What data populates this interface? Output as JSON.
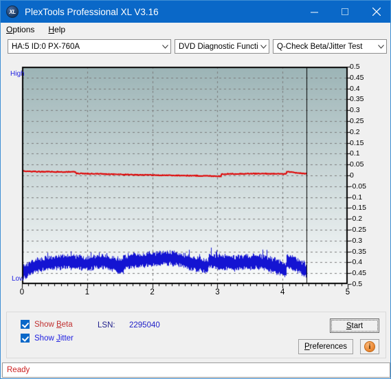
{
  "window": {
    "title": "PlexTools Professional XL V3.16",
    "icon": "XL",
    "icon_name": "plextools-app-icon",
    "minimize": "minimize-icon",
    "maximize": "maximize-icon",
    "close": "close-icon",
    "accent": "#0a68c8"
  },
  "menubar": {
    "items": [
      {
        "label": "Options",
        "accel": "O"
      },
      {
        "label": "Help",
        "accel": "H"
      }
    ]
  },
  "toolbar": {
    "drive": {
      "value": "HA:5 ID:0  PX-760A",
      "options": [
        "HA:5 ID:0  PX-760A"
      ]
    },
    "function": {
      "value": "DVD Diagnostic Functions",
      "options": [
        "DVD Diagnostic Functions"
      ]
    },
    "test": {
      "value": "Q-Check Beta/Jitter Test",
      "options": [
        "Q-Check Beta/Jitter Test"
      ]
    }
  },
  "chart_labels": {
    "high": "High",
    "low": "Low"
  },
  "controls": {
    "show_beta": {
      "label": "Show Beta",
      "accel": "B",
      "checked": true,
      "color": "#c03030"
    },
    "show_jitter": {
      "label": "Show Jitter",
      "accel": "J",
      "checked": true,
      "color": "#2020e0"
    },
    "lsn_label": "LSN:",
    "lsn_value": "2295040",
    "start_button": {
      "label": "Start",
      "accel": "S"
    },
    "preferences_button": {
      "label": "Preferences",
      "accel": "P"
    },
    "info_button": {
      "label": "i",
      "name": "info-icon"
    }
  },
  "statusbar": {
    "text": "Ready",
    "color": "#cc2020"
  },
  "chart_data": {
    "type": "line",
    "title": "Q-Check Beta/Jitter Test",
    "xlabel": "",
    "ylabel": "",
    "xlim": [
      0,
      5
    ],
    "ylim": [
      -0.5,
      0.5
    ],
    "xticks": [
      0,
      1,
      2,
      3,
      4,
      5
    ],
    "yticks": [
      0.5,
      0.45,
      0.4,
      0.35,
      0.3,
      0.25,
      0.2,
      0.15,
      0.1,
      0.05,
      0,
      -0.05,
      -0.1,
      -0.15,
      -0.2,
      -0.25,
      -0.3,
      -0.35,
      -0.4,
      -0.45,
      -0.5
    ],
    "ytick_labels": [
      "0.5",
      "0.45",
      "0.4",
      "0.35",
      "0.3",
      "0.25",
      "0.2",
      "0.15",
      "0.1",
      "0.05",
      "0",
      "-0.05",
      "-0.1",
      "-0.15",
      "-0.2",
      "-0.25",
      "-0.3",
      "-0.35",
      "-0.4",
      "-0.45",
      "-0.5"
    ],
    "xtick_labels": [
      "0",
      "1",
      "2",
      "3",
      "4",
      "5"
    ],
    "grid": true,
    "grid_style": "dashed",
    "grid_color": "#7a7a7a",
    "plot_bg_top": "#9cb4b6",
    "plot_bg_bottom": "#fbfcfc",
    "data_end_marker_x": 4.37,
    "legend_position": "none",
    "series": [
      {
        "name": "Beta",
        "color": "#e00000",
        "type": "line",
        "x": [
          0.0,
          0.1,
          0.25,
          0.45,
          0.6,
          0.75,
          0.82,
          0.83,
          1.0,
          1.2,
          1.45,
          1.7,
          1.9,
          2.1,
          2.35,
          2.55,
          2.75,
          2.95,
          3.05,
          3.06,
          3.25,
          3.5,
          3.75,
          3.95,
          4.05,
          4.06,
          4.15,
          4.25,
          4.37
        ],
        "y": [
          0.02,
          0.018,
          0.017,
          0.017,
          0.016,
          0.016,
          0.016,
          0.009,
          0.008,
          0.007,
          0.005,
          0.003,
          0.002,
          0.001,
          0.0,
          -0.001,
          -0.002,
          -0.003,
          -0.004,
          0.006,
          0.007,
          0.008,
          0.008,
          0.007,
          0.006,
          0.017,
          0.014,
          0.01,
          0.008
        ]
      },
      {
        "name": "Jitter",
        "color": "#1414d2",
        "type": "band",
        "x": [
          0.0,
          0.12,
          0.25,
          0.4,
          0.55,
          0.7,
          0.85,
          1.0,
          1.15,
          1.3,
          1.45,
          1.55,
          1.56,
          1.7,
          1.85,
          2.0,
          2.15,
          2.3,
          2.45,
          2.6,
          2.75,
          2.85,
          2.86,
          3.0,
          3.15,
          3.3,
          3.45,
          3.6,
          3.75,
          3.9,
          4.0,
          4.05,
          4.06,
          4.15,
          4.25,
          4.37
        ],
        "y_upper": [
          -0.42,
          -0.4,
          -0.385,
          -0.378,
          -0.372,
          -0.368,
          -0.372,
          -0.378,
          -0.368,
          -0.37,
          -0.386,
          -0.392,
          -0.372,
          -0.365,
          -0.362,
          -0.358,
          -0.355,
          -0.352,
          -0.36,
          -0.378,
          -0.382,
          -0.394,
          -0.366,
          -0.37,
          -0.372,
          -0.375,
          -0.37,
          -0.368,
          -0.378,
          -0.392,
          -0.402,
          -0.406,
          -0.368,
          -0.374,
          -0.39,
          -0.41
        ],
        "y_lower": [
          -0.472,
          -0.455,
          -0.44,
          -0.432,
          -0.428,
          -0.424,
          -0.428,
          -0.434,
          -0.424,
          -0.426,
          -0.442,
          -0.45,
          -0.428,
          -0.42,
          -0.418,
          -0.414,
          -0.41,
          -0.408,
          -0.416,
          -0.434,
          -0.44,
          -0.452,
          -0.422,
          -0.426,
          -0.428,
          -0.432,
          -0.426,
          -0.424,
          -0.434,
          -0.45,
          -0.462,
          -0.466,
          -0.424,
          -0.43,
          -0.448,
          -0.47
        ]
      }
    ]
  }
}
